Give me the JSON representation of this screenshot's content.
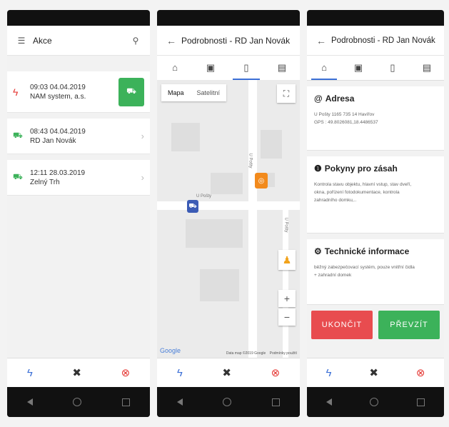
{
  "colors": {
    "accent": "#3b6fd6",
    "green": "#3cb25a",
    "red": "#e84c4f",
    "alarm": "#e53935",
    "ok": "#3cb25a",
    "orange": "#f28a1c",
    "gray_text": "#666"
  },
  "nav": {
    "back_icon": "back-icon",
    "home_icon": "home-icon",
    "recent_icon": "recent-apps-icon"
  },
  "phone1": {
    "menu_icon": "☰",
    "title": "Akce",
    "link_icon": "🔗",
    "items": [
      {
        "icon": "bolt-icon",
        "glyph": "ϟ",
        "line1": "09:03 04.04.2019",
        "line2": "NAM system, a.s.",
        "has_action": true,
        "action_glyph": "🚗"
      },
      {
        "icon": "car-icon",
        "glyph": "🚗",
        "line1": "08:43 04.04.2019",
        "line2": "RD Jan Novák",
        "chev": "›"
      },
      {
        "icon": "car-icon",
        "glyph": "🚗",
        "line1": "12:11 28.03.2019",
        "line2": "Zelný Trh",
        "chev": "›"
      }
    ],
    "bottom": {
      "bolt": "ϟ",
      "tools": "✖",
      "sos": "⊗"
    }
  },
  "phone2": {
    "back": "←",
    "title": "Podrobnosti - RD Jan Novák",
    "tabs": [
      "⌂",
      "▣",
      "▯",
      "▤"
    ],
    "map": {
      "type_map": "Mapa",
      "type_sat": "Satelitní",
      "street1": "U Pošty",
      "street2": "U Pošty",
      "street3": "U Pošty",
      "zoom_in": "+",
      "zoom_out": "−",
      "pegman": "♟",
      "fullscreen": "⛶",
      "google": "Google",
      "footer1": "Data map ©2019 Google",
      "footer2": "Podmínky použití"
    },
    "bottom": {
      "bolt": "ϟ",
      "tools": "✖",
      "sos": "⊗"
    }
  },
  "phone3": {
    "back": "←",
    "title": "Podrobnosti - RD Jan Novák",
    "tabs": [
      "⌂",
      "▣",
      "▯",
      "▤"
    ],
    "cards": [
      {
        "icon": "@",
        "title": "Adresa",
        "lines": [
          "U Pošty 1165 735 14 Havířov",
          "GPS : 49.8026081,18.4486537"
        ]
      },
      {
        "icon": "❶",
        "title": "Pokyny pro zásah",
        "lines": [
          "Kontrola stavu objektu, hlavní vstup, stav dveří,",
          "okna, pořízení fotodokumentace, kontrola",
          "zahradního domku,.."
        ]
      },
      {
        "icon": "⚙",
        "title": "Technické informace",
        "lines": [
          "běžný zabezpečovací systém, pouze vnitřní čidla",
          "+ zahradní domek"
        ]
      }
    ],
    "btn_end": "UKONČIT",
    "btn_take": "PŘEVZÍT",
    "bottom": {
      "bolt": "ϟ",
      "tools": "✖",
      "sos": "⊗"
    }
  }
}
